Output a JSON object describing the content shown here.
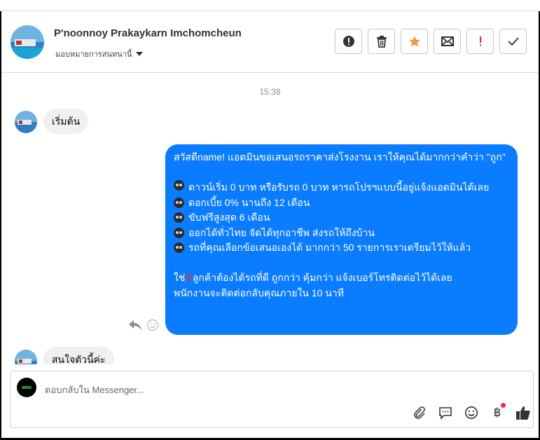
{
  "header": {
    "contact_name": "P'noonnoy Prakaykarn Imchomcheun",
    "assign_label": "มอบหมายการสนทนานี้"
  },
  "actions": [
    {
      "name": "mark-spam",
      "icon": "exclamation-circle-icon"
    },
    {
      "name": "delete",
      "icon": "trash-icon"
    },
    {
      "name": "star",
      "icon": "star-icon",
      "color": "#f7923a"
    },
    {
      "name": "mark-unread",
      "icon": "envelope-icon"
    },
    {
      "name": "follow-up",
      "icon": "exclamation-mark-icon",
      "color": "#f02849"
    },
    {
      "name": "mark-done",
      "icon": "check-icon"
    }
  ],
  "chat": {
    "timestamp": "15:38",
    "messages": [
      {
        "from": "customer",
        "text": "เริ่มต้น"
      },
      {
        "from": "page",
        "lines": [
          "สวัสดีname! แอดมินขอเสนอรถราคาส่งโรงงาน เราให้คุณได้มากกว่าคำว่า \"ถูก\"",
          "",
          "ดาวน์เริ่ม 0 บาท หรือรับรถ 0 บาท หารถโปรฯแบบนี้อยู่แจ้งแอดมินได้เลย",
          "ดอกเบี้ย 0% นานถึง 12 เดือน",
          "ขับฟรีสูงสุด 6 เดือน",
          "ออกได้ทั่วไทย จัดได้ทุกอาชีพ ส่งรถให้ถึงบ้าน",
          "รถที่คุณเลือกข้อเสนอเองได้ มากกว่า 50 รายการเราเตรียมไว้ให้แล้ว",
          "",
          "ใช่",
          "ลูกค้าต้องได้รถที่ดี ถูกกว่า คุ้มกว่า แจ้งเบอร์โทรติดต่อไว้ได้เลย",
          "พนักงานจะติดต่อกลับคุณภายใน 10 นาที"
        ]
      },
      {
        "from": "customer",
        "text": "สนใจตัวนี้ค่ะ"
      }
    ]
  },
  "composer": {
    "placeholder": "ตอบกลับใน Messenger...",
    "currency_symbol": "฿"
  },
  "colors": {
    "outgoing_bubble": "#0a7cff",
    "incoming_bubble": "#f0f0f0",
    "accent_star": "#f7923a",
    "alert_red": "#f02849"
  }
}
